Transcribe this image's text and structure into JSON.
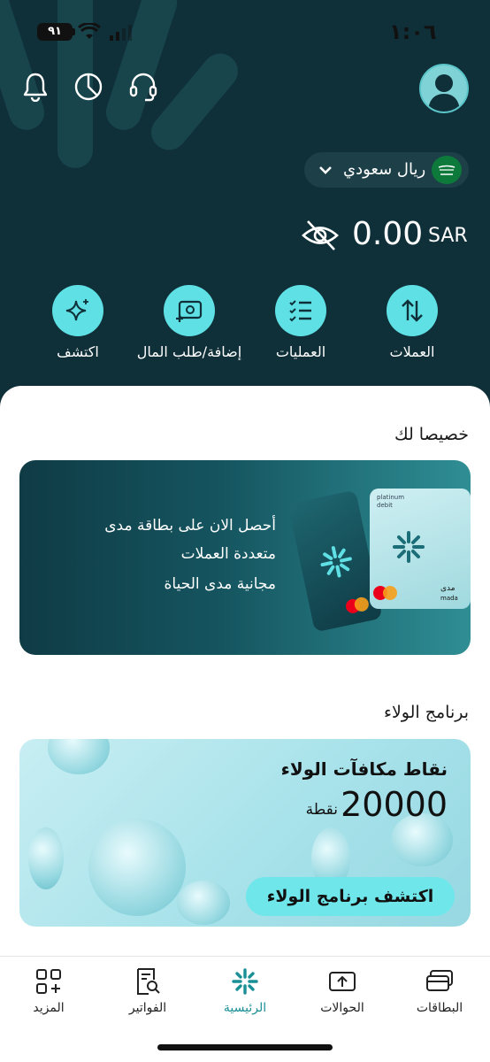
{
  "status_bar": {
    "time": "١:٠٦",
    "battery": "٩١"
  },
  "header": {
    "currency_selector": "ريال سعودي",
    "balance_currency": "SAR",
    "balance_amount": "0.00"
  },
  "actions": [
    {
      "label": "العملات",
      "icon": "swap-vertical-icon"
    },
    {
      "label": "العمليات",
      "icon": "checklist-icon"
    },
    {
      "label": "إضافة/طلب المال",
      "icon": "add-money-icon"
    },
    {
      "label": "اكتشف",
      "icon": "sparkles-icon"
    }
  ],
  "for_you": {
    "title": "خصيصا لك",
    "promo_line1": "أحصل الان على بطاقة مدى",
    "promo_line2": "متعددة العملات",
    "promo_line3": "مجانية مدى الحياة",
    "card_label1": "platinum",
    "card_label2": "debit",
    "mada_text": "مدى",
    "mada_latin": "mada"
  },
  "loyalty": {
    "section_title": "برنامج الولاء",
    "title": "نقاط مكافآت الولاء",
    "points": "20000",
    "points_unit": "نقطة",
    "button": "اكتشف برنامج الولاء"
  },
  "tabbar": [
    {
      "label": "البطاقات",
      "icon": "cards-icon"
    },
    {
      "label": "الحوالات",
      "icon": "transfers-icon"
    },
    {
      "label": "الرئيسية",
      "icon": "home-logo-icon"
    },
    {
      "label": "الفواتير",
      "icon": "bills-icon"
    },
    {
      "label": "المزيد",
      "icon": "more-grid-icon"
    }
  ],
  "colors": {
    "header_bg": "#0f3039",
    "accent": "#5fe0e4",
    "active_tab": "#1a8f95"
  }
}
